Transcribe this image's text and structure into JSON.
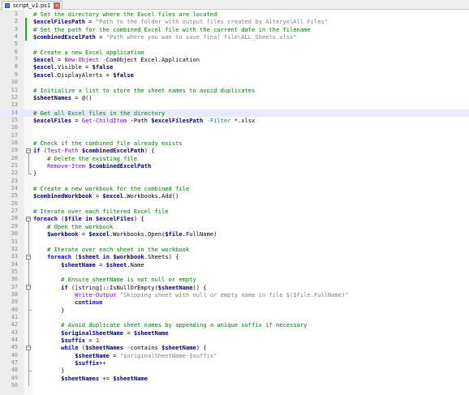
{
  "tab": {
    "title": "script_v1.ps1",
    "close_glyph": "×",
    "icon": "file-icon"
  },
  "lines": [
    [
      [
        "c",
        "# Set the directory where the Excel files are located"
      ]
    ],
    [
      [
        "v",
        "$excelFilesPath"
      ],
      [
        "o",
        " = "
      ],
      [
        "s",
        "\"Path to the folder with output files created by Alteryx\\All Files\""
      ]
    ],
    [
      [
        "c",
        "# Set the path for the combined Excel file with the current date in the filename"
      ]
    ],
    [
      [
        "v",
        "$combinedExcelPath"
      ],
      [
        "o",
        " = "
      ],
      [
        "s",
        "\"Path where you wan to save final file\\ALL_Sheets.xlsx\""
      ]
    ],
    [],
    [
      [
        "c",
        "# Create a new Excel application"
      ]
    ],
    [
      [
        "v",
        "$excel"
      ],
      [
        "o",
        " = "
      ],
      [
        "cm",
        "New-Object"
      ],
      [
        "o",
        " -ComObject Excel.Application"
      ]
    ],
    [
      [
        "v",
        "$excel"
      ],
      [
        "o",
        ".Visible = "
      ],
      [
        "v",
        "$false"
      ]
    ],
    [
      [
        "v",
        "$excel"
      ],
      [
        "o",
        ".DisplayAlerts = "
      ],
      [
        "v",
        "$false"
      ]
    ],
    [],
    [
      [
        "c",
        "# Initialize a list to store the sheet names to avoid duplicates"
      ]
    ],
    [
      [
        "v",
        "$sheetNames"
      ],
      [
        "o",
        " = @()"
      ]
    ],
    [],
    [
      [
        "c",
        "# Get all Excel files in the directory"
      ]
    ],
    [
      [
        "v",
        "$excelFiles"
      ],
      [
        "o",
        " = "
      ],
      [
        "cm",
        "Get-ChildItem"
      ],
      [
        "o",
        " -Path "
      ],
      [
        "v",
        "$excelFilesPath"
      ],
      [
        "o",
        " "
      ],
      [
        "p",
        "-Filter"
      ],
      [
        "o",
        " *.xlsx"
      ]
    ],
    [],
    [],
    [
      [
        "c",
        "# Check if the combined file already exists"
      ]
    ],
    [
      [
        "k",
        "if"
      ],
      [
        "o",
        " ("
      ],
      [
        "cm",
        "Test-Path"
      ],
      [
        "o",
        " "
      ],
      [
        "v",
        "$combinedExcelPath"
      ],
      [
        "o",
        ") {"
      ]
    ],
    [
      [
        "o",
        "    "
      ],
      [
        "c",
        "# Delete the existing file"
      ]
    ],
    [
      [
        "o",
        "    "
      ],
      [
        "cm",
        "Remove-Item"
      ],
      [
        "o",
        " "
      ],
      [
        "v",
        "$combinedExcelPath"
      ]
    ],
    [
      [
        "o",
        "}"
      ]
    ],
    [],
    [
      [
        "c",
        "# Create a new workbook for the combined file"
      ]
    ],
    [
      [
        "v",
        "$combinedWorkbook"
      ],
      [
        "o",
        " = "
      ],
      [
        "v",
        "$excel"
      ],
      [
        "o",
        ".Workbooks.Add()"
      ]
    ],
    [],
    [
      [
        "c",
        "# Iterate over each filtered Excel file"
      ]
    ],
    [
      [
        "k",
        "foreach"
      ],
      [
        "o",
        " ("
      ],
      [
        "v",
        "$file"
      ],
      [
        "o",
        " "
      ],
      [
        "k",
        "in"
      ],
      [
        "o",
        " "
      ],
      [
        "v",
        "$excelFiles"
      ],
      [
        "o",
        ") {"
      ]
    ],
    [
      [
        "o",
        "    "
      ],
      [
        "c",
        "# Open the workbook"
      ]
    ],
    [
      [
        "o",
        "    "
      ],
      [
        "v",
        "$workbook"
      ],
      [
        "o",
        " = "
      ],
      [
        "v",
        "$excel"
      ],
      [
        "o",
        ".Workbooks.Open("
      ],
      [
        "v",
        "$file"
      ],
      [
        "o",
        ".FullName)"
      ]
    ],
    [],
    [
      [
        "o",
        "    "
      ],
      [
        "c",
        "# Iterate over each sheet in the workbook"
      ]
    ],
    [
      [
        "o",
        "    "
      ],
      [
        "k",
        "foreach"
      ],
      [
        "o",
        " ("
      ],
      [
        "v",
        "$sheet"
      ],
      [
        "o",
        " "
      ],
      [
        "k",
        "in"
      ],
      [
        "o",
        " "
      ],
      [
        "v",
        "$workbook"
      ],
      [
        "o",
        ".Sheets) {"
      ]
    ],
    [
      [
        "o",
        "        "
      ],
      [
        "v",
        "$sheetName"
      ],
      [
        "o",
        " = "
      ],
      [
        "v",
        "$sheet"
      ],
      [
        "o",
        ".Name"
      ]
    ],
    [],
    [
      [
        "o",
        "        "
      ],
      [
        "c",
        "# Ensure sheetName is not null or empty"
      ]
    ],
    [
      [
        "o",
        "        "
      ],
      [
        "k",
        "if"
      ],
      [
        "o",
        " ([string]::IsNullOrEmpty("
      ],
      [
        "v",
        "$sheetName"
      ],
      [
        "o",
        ")) {"
      ]
    ],
    [
      [
        "o",
        "            "
      ],
      [
        "cm",
        "Write-Output"
      ],
      [
        "o",
        " "
      ],
      [
        "s",
        "\"Skipping sheet with null or empty name in file $($file.FullName)\""
      ]
    ],
    [
      [
        "o",
        "            "
      ],
      [
        "k",
        "continue"
      ]
    ],
    [
      [
        "o",
        "        }"
      ]
    ],
    [],
    [
      [
        "o",
        "        "
      ],
      [
        "c",
        "# Avoid duplicate sheet names by appending a unique suffix if necessary"
      ]
    ],
    [
      [
        "o",
        "        "
      ],
      [
        "v",
        "$originalSheetName"
      ],
      [
        "o",
        " = "
      ],
      [
        "v",
        "$sheetName"
      ]
    ],
    [
      [
        "o",
        "        "
      ],
      [
        "v",
        "$suffix"
      ],
      [
        "o",
        " = "
      ],
      [
        "n",
        "1"
      ]
    ],
    [
      [
        "o",
        "        "
      ],
      [
        "k",
        "while"
      ],
      [
        "o",
        " ("
      ],
      [
        "v",
        "$sheetNames"
      ],
      [
        "o",
        " -contains "
      ],
      [
        "v",
        "$sheetName"
      ],
      [
        "o",
        ") {"
      ]
    ],
    [
      [
        "o",
        "            "
      ],
      [
        "v",
        "$sheetName"
      ],
      [
        "o",
        " = "
      ],
      [
        "s",
        "\"$originalSheetName-$suffix\""
      ]
    ],
    [
      [
        "o",
        "            "
      ],
      [
        "v",
        "$suffix"
      ],
      [
        "o",
        "++"
      ]
    ],
    [
      [
        "o",
        "        }"
      ]
    ],
    [
      [
        "o",
        "        "
      ],
      [
        "v",
        "$sheetNames"
      ],
      [
        "o",
        " += "
      ],
      [
        "v",
        "$sheetName"
      ]
    ],
    []
  ],
  "line_numbers": [
    "1",
    "2",
    "3",
    "4",
    "5",
    "6",
    "7",
    "8",
    "9",
    "10",
    "11",
    "12",
    "13",
    "14",
    "15",
    "16",
    "17",
    "18",
    "19",
    "20",
    "21",
    "22",
    "23",
    "24",
    "25",
    "26",
    "27",
    "28",
    "29",
    "30",
    "31",
    "32",
    "33",
    "34",
    "35",
    "36",
    "37",
    "38",
    "39",
    "40",
    "41",
    "42",
    "43",
    "44",
    "45",
    "46",
    "47",
    "48",
    "49",
    "50"
  ],
  "changed_lines": [
    2,
    3,
    4
  ],
  "highlighted_line": 14,
  "fold_markers": {
    "open": "−",
    "close": "−"
  }
}
